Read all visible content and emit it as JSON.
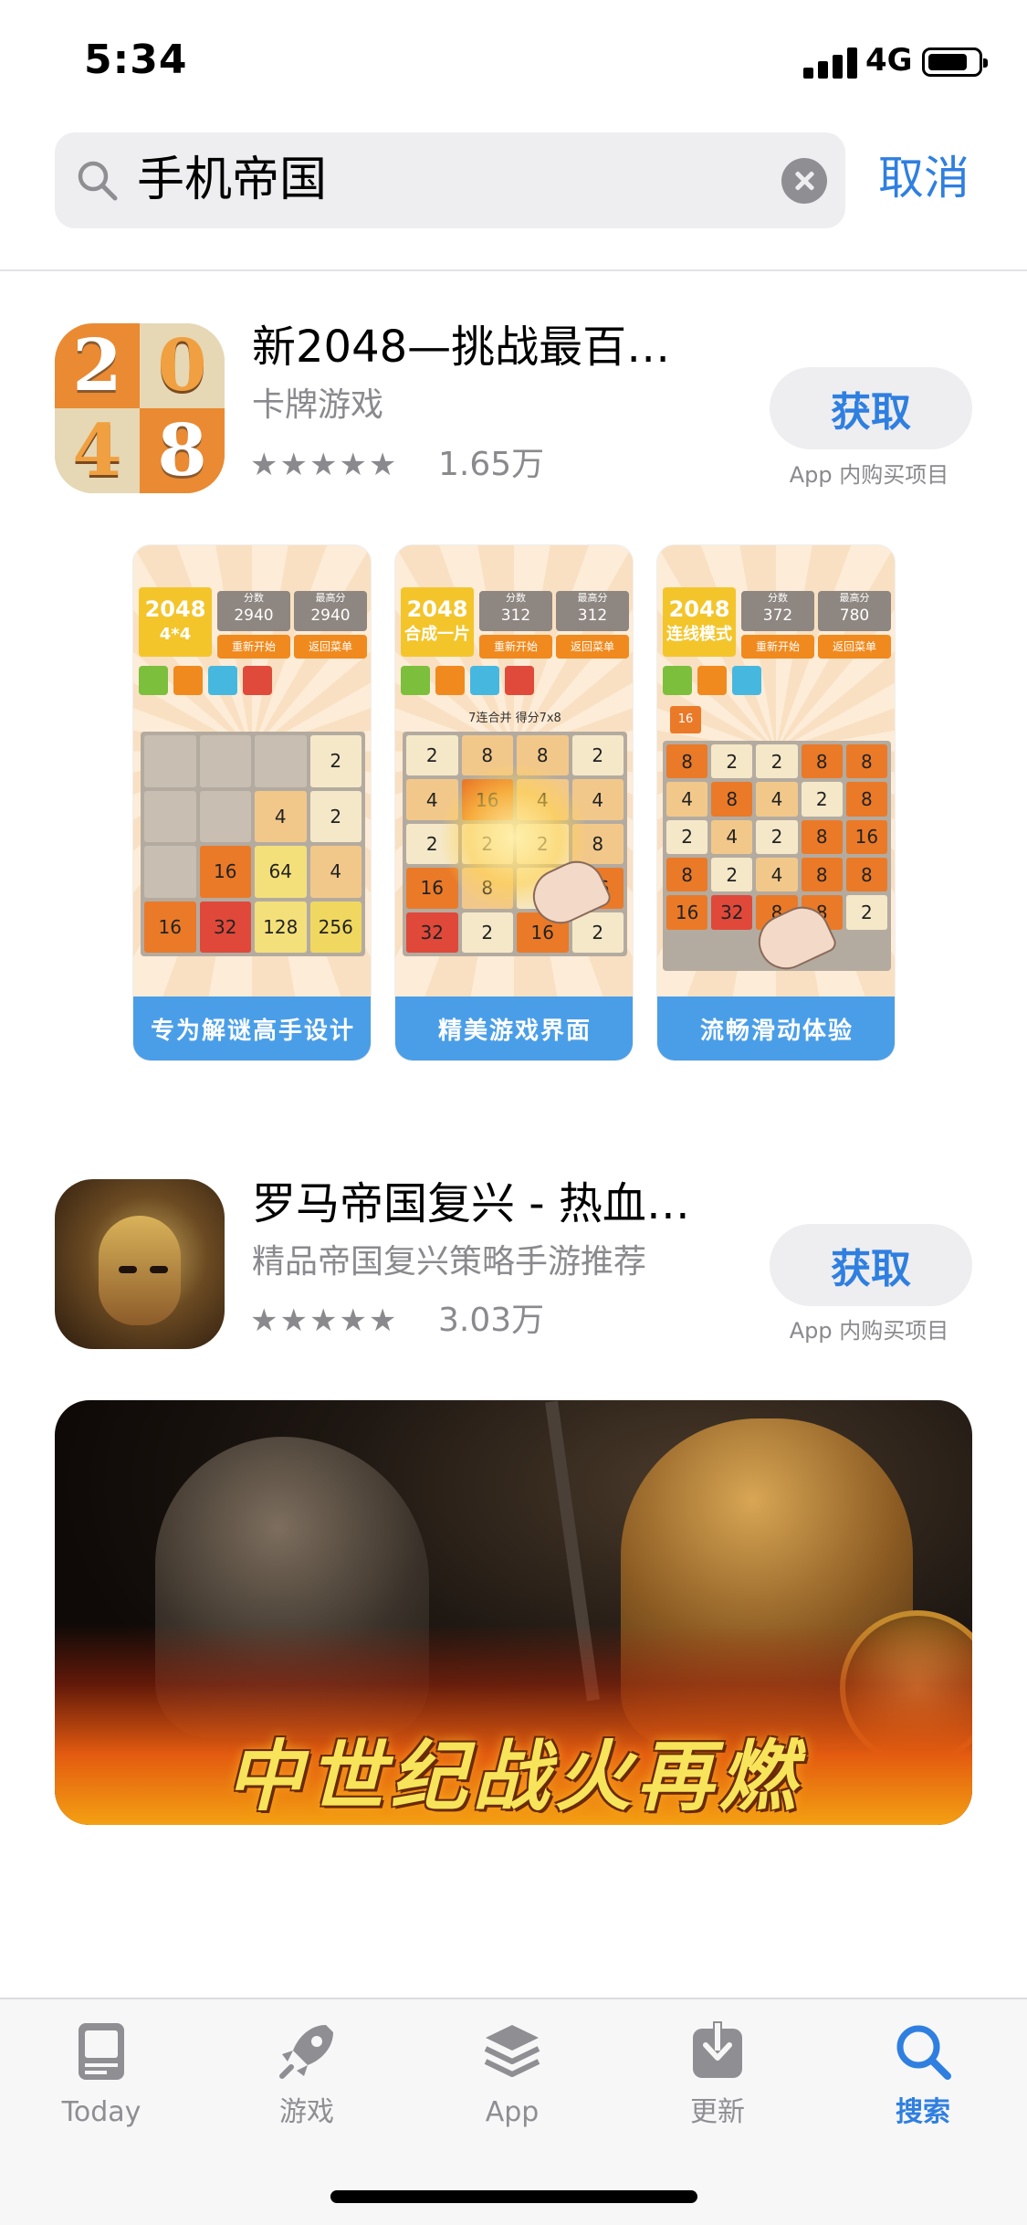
{
  "status_bar": {
    "time": "5:34",
    "network": "4G"
  },
  "search": {
    "query": "手机帝国",
    "cancel_label": "取消"
  },
  "results": [
    {
      "title": "新2048—挑战最百…",
      "subtitle": "卡牌游戏",
      "stars": "★★★★★",
      "rating_count": "1.65万",
      "get_label": "获取",
      "iap_note": "App 内购买项目",
      "icon_digits": [
        "2",
        "0",
        "4",
        "8"
      ],
      "screenshots": [
        {
          "logo": "2048",
          "logo_sub": "4*4",
          "score_label": "分数",
          "score": "2940",
          "best_label": "最高分",
          "best": "2940",
          "restart": "重新开始",
          "menu": "返回菜单",
          "info": "",
          "tiles": [
            "",
            "",
            "",
            "2",
            "",
            "",
            "4",
            "2",
            "",
            "16",
            "64",
            "4",
            "16",
            "32",
            "128",
            "256"
          ],
          "caption": "专为解谜高手设计"
        },
        {
          "logo": "2048",
          "logo_sub": "合成一片",
          "score_label": "分数",
          "score": "312",
          "best_label": "最高分",
          "best": "312",
          "restart": "重新开始",
          "menu": "返回菜单",
          "info": "7连合并  得分7x8",
          "tiles": [
            "2",
            "8",
            "8",
            "2",
            "4",
            "16",
            "4",
            "4",
            "2",
            "2",
            "2",
            "8",
            "16",
            "8",
            "2",
            "16",
            "32",
            "2",
            "16",
            "2"
          ],
          "caption": "精美游戏界面"
        },
        {
          "logo": "2048",
          "logo_sub": "连线模式",
          "score_label": "分数",
          "score": "372",
          "best_label": "最高分",
          "best": "780",
          "restart": "重新开始",
          "menu": "返回菜单",
          "info": "16",
          "tiles": [
            "8",
            "2",
            "2",
            "8",
            "8",
            "4",
            "8",
            "4",
            "2",
            "8",
            "2",
            "4",
            "2",
            "8",
            "16",
            "8",
            "2",
            "4",
            "8",
            "8",
            "16",
            "32",
            "8",
            "8",
            "2"
          ],
          "caption": "流畅滑动体验"
        }
      ]
    },
    {
      "title": "罗马帝国复兴 - 热血…",
      "subtitle": "精品帝国复兴策略手游推荐",
      "stars": "★★★★★",
      "rating_count": "3.03万",
      "get_label": "获取",
      "iap_note": "App 内购买项目",
      "banner_text": "中世纪战火再燃"
    }
  ],
  "tab_bar": {
    "tabs": [
      {
        "label": "Today",
        "icon": "today-icon"
      },
      {
        "label": "游戏",
        "icon": "rocket-icon"
      },
      {
        "label": "App",
        "icon": "layers-icon"
      },
      {
        "label": "更新",
        "icon": "download-icon"
      },
      {
        "label": "搜索",
        "icon": "search-icon"
      }
    ],
    "active": "搜索"
  },
  "colors": {
    "accent": "#2f7fe0",
    "secondary_text": "#8a8a8e",
    "tile_orange": "#ea8a32"
  }
}
